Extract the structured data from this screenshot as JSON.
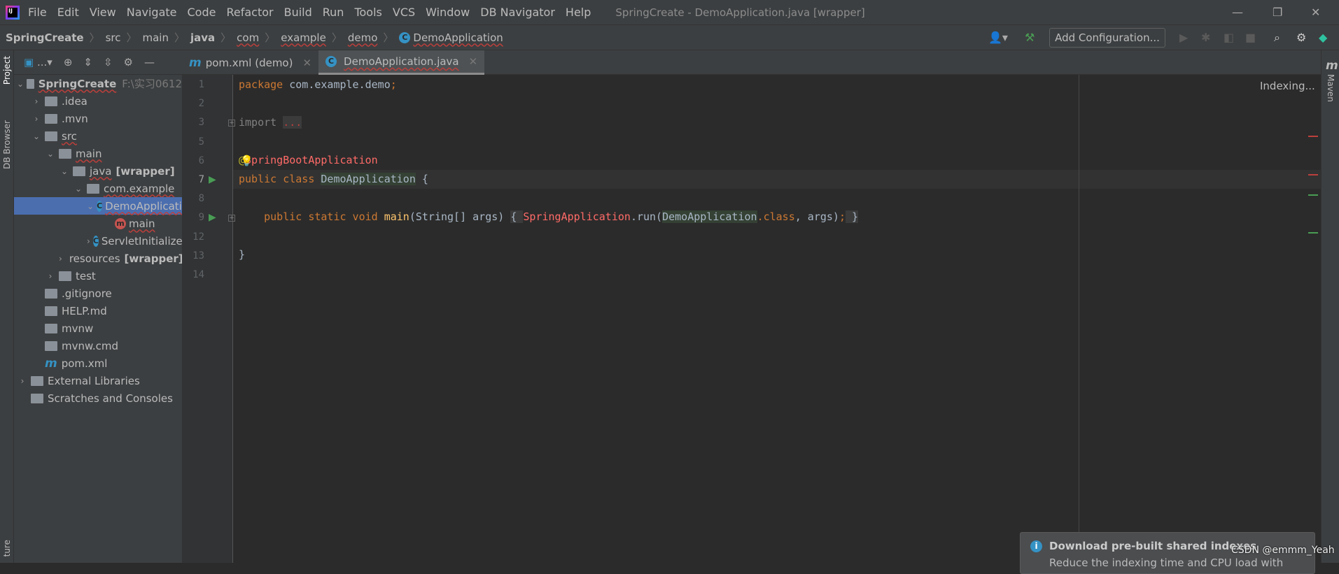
{
  "menubar": {
    "items": [
      "File",
      "Edit",
      "View",
      "Navigate",
      "Code",
      "Refactor",
      "Build",
      "Run",
      "Tools",
      "VCS",
      "Window",
      "DB Navigator",
      "Help"
    ],
    "title": "SpringCreate - DemoApplication.java [wrapper]"
  },
  "breadcrumb": [
    "SpringCreate",
    "src",
    "main",
    "java",
    "com",
    "example",
    "demo",
    "DemoApplication"
  ],
  "toolbar": {
    "add_config": "Add Configuration..."
  },
  "left_tools": [
    "Project",
    "DB Browser",
    "ture"
  ],
  "right_tools": [
    "Maven"
  ],
  "project": {
    "header": "...",
    "tree": [
      {
        "label": "SpringCreate",
        "extra": "F:\\实习0612",
        "depth": 0,
        "arrow": "open"
      },
      {
        "label": ".idea",
        "depth": 1,
        "arrow": "closed"
      },
      {
        "label": ".mvn",
        "depth": 1,
        "arrow": "closed"
      },
      {
        "label": "src",
        "depth": 1,
        "arrow": "open"
      },
      {
        "label": "main",
        "depth": 2,
        "arrow": "open"
      },
      {
        "label": "java",
        "extra": "[wrapper]",
        "depth": 3,
        "arrow": "open"
      },
      {
        "label": "com.example",
        "depth": 4,
        "arrow": "open"
      },
      {
        "label": "DemoApplication",
        "depth": 5,
        "arrow": "open",
        "selected": true
      },
      {
        "label": "main",
        "depth": 6
      },
      {
        "label": "ServletInitializer",
        "depth": 5,
        "arrow": "closed"
      },
      {
        "label": "resources",
        "extra": "[wrapper]",
        "depth": 3,
        "arrow": "closed"
      },
      {
        "label": "test",
        "depth": 2,
        "arrow": "closed"
      },
      {
        "label": ".gitignore",
        "depth": 1
      },
      {
        "label": "HELP.md",
        "depth": 1
      },
      {
        "label": "mvnw",
        "depth": 1
      },
      {
        "label": "mvnw.cmd",
        "depth": 1
      },
      {
        "label": "pom.xml",
        "depth": 1
      },
      {
        "label": "External Libraries",
        "depth": 0,
        "arrow": "closed"
      },
      {
        "label": "Scratches and Consoles",
        "depth": 0
      }
    ]
  },
  "tabs": [
    {
      "label": "pom.xml (demo)",
      "active": false
    },
    {
      "label": "DemoApplication.java",
      "active": true
    }
  ],
  "editor": {
    "line_numbers": [
      "1",
      "2",
      "3",
      "5",
      "6",
      "7",
      "8",
      "9",
      "12",
      "13",
      "14"
    ],
    "code": {
      "l1a": "package",
      "l1b": " com.example.demo",
      "l1c": ";",
      "l3a": "import ",
      "l3b": "...",
      "l6a": "@",
      "l6b": "SpringBootApplication",
      "l7a": "public class ",
      "l7b": "DemoApplication",
      "l7c": " {",
      "l9a": "    public static void ",
      "l9b": "main",
      "l9c": "(String[] args) ",
      "l9d": "{ ",
      "l9e": "SpringApplication",
      "l9f": ".run(",
      "l9g": "DemoApplication",
      "l9h": ".class",
      "l9i": ", args)",
      "l9j": ";",
      "l9k": " }",
      "l13": "}"
    },
    "status": "Indexing..."
  },
  "notification": {
    "title": "Download pre-built shared indexes",
    "body": "Reduce the indexing time and CPU load with"
  },
  "watermark": "CSDN @emmm_Yeah",
  "colors": {
    "accent": "#3592c4",
    "selection": "#4b6eaf",
    "run": "#499c54"
  }
}
